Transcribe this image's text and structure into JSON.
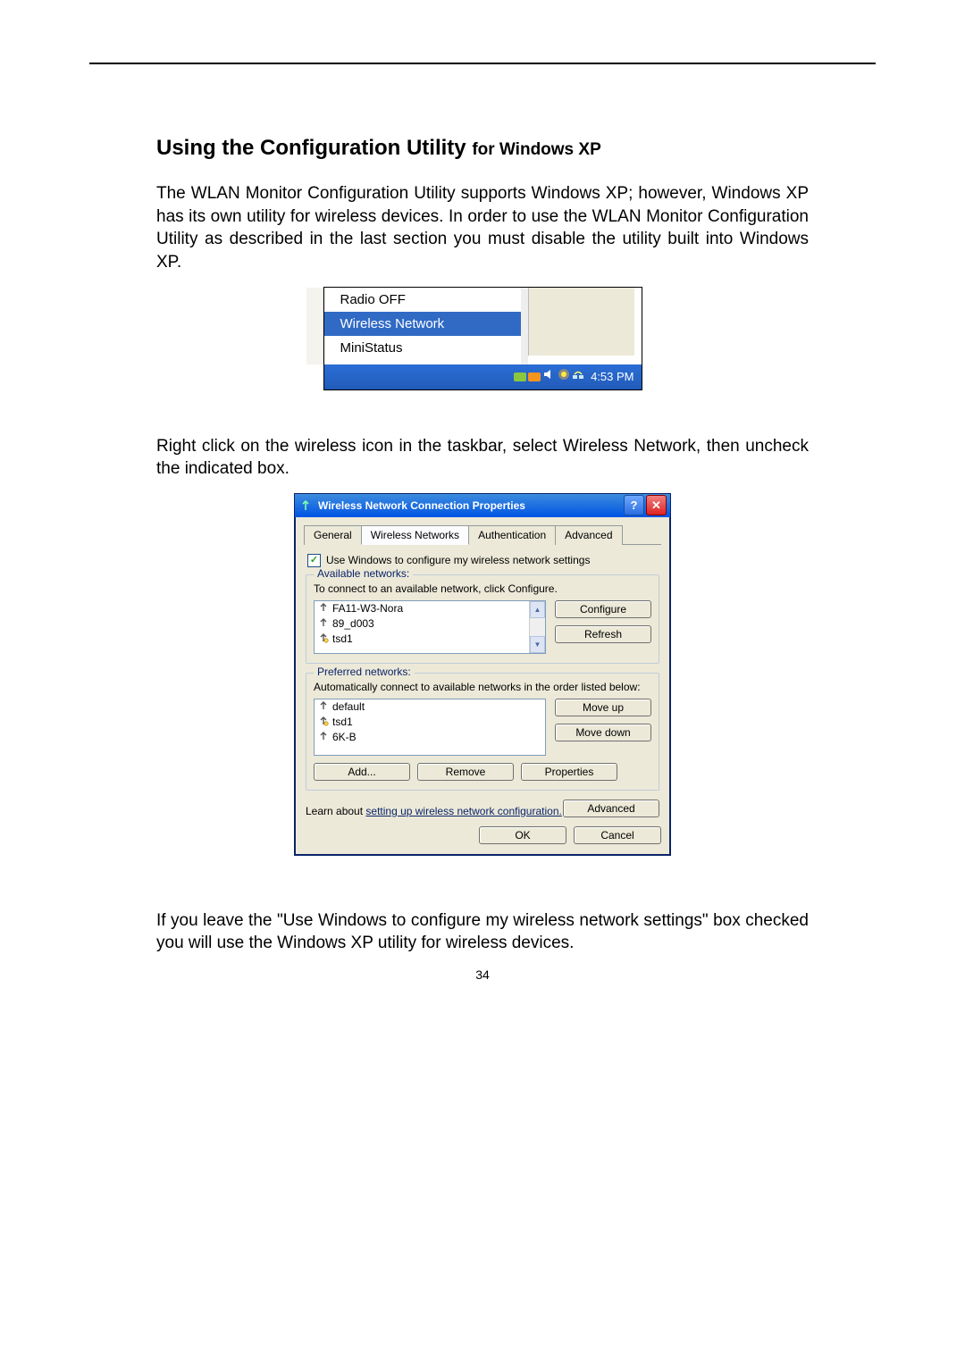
{
  "doc": {
    "heading_main": "Using the Configuration Utility ",
    "heading_sub": "for Windows XP",
    "para1": "The WLAN Monitor Configuration Utility supports Windows XP; however, Windows XP has its own utility for wireless devices. In order to use the WLAN Monitor Configuration Utility as described in the last section you must disable the utility built into Windows XP.",
    "para2": "Right click on the wireless icon in the taskbar, select Wireless Network, then uncheck the indicated box.",
    "para3": "If you leave the \"Use Windows to configure my wireless network settings\" box checked you will use the Windows XP utility for wireless devices.",
    "page_number": "34"
  },
  "tray_menu": {
    "items": [
      "Radio OFF",
      "Wireless Network",
      "MiniStatus"
    ],
    "selected_index": 1,
    "clock": "4:53 PM"
  },
  "dialog": {
    "title": "Wireless Network Connection Properties",
    "tabs": [
      "General",
      "Wireless Networks",
      "Authentication",
      "Advanced"
    ],
    "active_tab_index": 1,
    "checkbox_label": "Use Windows to configure my wireless network settings",
    "checkbox_checked": true,
    "available": {
      "legend": "Available networks:",
      "desc": "To connect to an available network, click Configure.",
      "items": [
        {
          "name": "FA11-W3-Nora",
          "secure": false
        },
        {
          "name": "89_d003",
          "secure": false
        },
        {
          "name": "tsd1",
          "secure": true
        }
      ],
      "buttons": {
        "configure": "Configure",
        "refresh": "Refresh"
      }
    },
    "preferred": {
      "legend": "Preferred networks:",
      "desc": "Automatically connect to available networks in the order listed below:",
      "items": [
        {
          "name": "default",
          "secure": false
        },
        {
          "name": "tsd1",
          "secure": true
        },
        {
          "name": "6K-B",
          "secure": false
        }
      ],
      "buttons": {
        "move_up": "Move up",
        "move_down": "Move down",
        "add": "Add...",
        "remove": "Remove",
        "properties": "Properties"
      }
    },
    "learn_text_pre": "Learn about ",
    "learn_link": "setting up wireless network configuration.",
    "advanced_btn": "Advanced",
    "ok_btn": "OK",
    "cancel_btn": "Cancel"
  }
}
